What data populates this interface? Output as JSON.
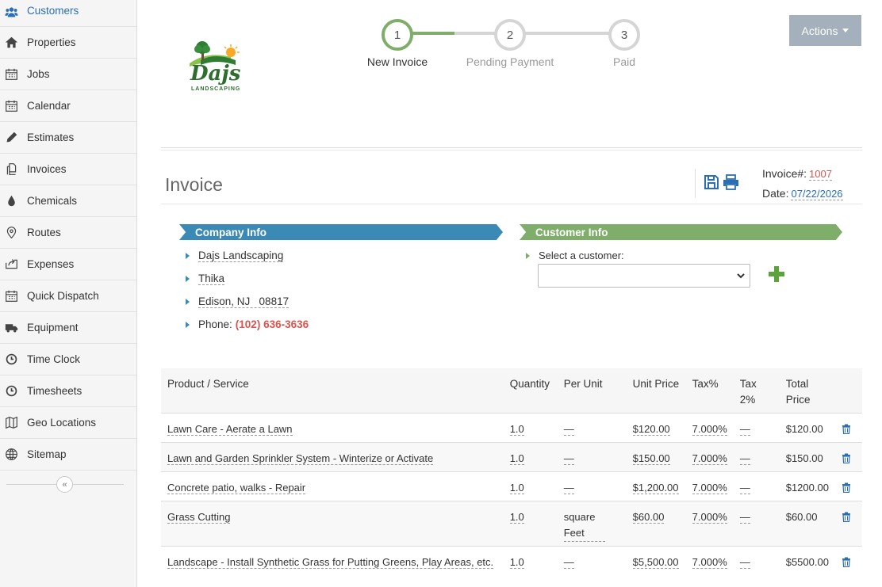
{
  "sidebar": {
    "items": [
      {
        "label": "Customers",
        "icon": "users-icon",
        "active": true
      },
      {
        "label": "Properties",
        "icon": "home-icon"
      },
      {
        "label": "Jobs",
        "icon": "calendar-icon"
      },
      {
        "label": "Calendar",
        "icon": "calendar-icon"
      },
      {
        "label": "Estimates",
        "icon": "pencil-icon"
      },
      {
        "label": "Invoices",
        "icon": "copy-icon"
      },
      {
        "label": "Chemicals",
        "icon": "drop-icon"
      },
      {
        "label": "Routes",
        "icon": "map-marker-icon"
      },
      {
        "label": "Expenses",
        "icon": "share-icon"
      },
      {
        "label": "Quick Dispatch",
        "icon": "calendar-icon"
      },
      {
        "label": "Equipment",
        "icon": "truck-icon"
      },
      {
        "label": "Time Clock",
        "icon": "clock-icon"
      },
      {
        "label": "Timesheets",
        "icon": "clock-icon"
      },
      {
        "label": "Geo Locations",
        "icon": "map-icon"
      },
      {
        "label": "Sitemap",
        "icon": "globe-icon"
      }
    ],
    "collapse_glyph": "«"
  },
  "logo": {
    "text": "Dajs",
    "subtext": "LANDSCAPING"
  },
  "steps": [
    {
      "number": "1",
      "label": "New Invoice",
      "done": true
    },
    {
      "number": "2",
      "label": "Pending Payment",
      "done": false
    },
    {
      "number": "3",
      "label": "Paid",
      "done": false
    }
  ],
  "actions_label": "Actions",
  "invoice": {
    "title": "Invoice",
    "number_label": "Invoice#:",
    "number": "1007",
    "date_label": "Date:",
    "date": "07/22/2026"
  },
  "company": {
    "banner": "Company Info",
    "name": "Dajs Landscaping",
    "line2": "Thika",
    "city_state": "Edison, NJ",
    "zip": "08817",
    "phone_label": "Phone:",
    "phone": "(102) 636-3636"
  },
  "customer": {
    "banner": "Customer Info",
    "select_label": "Select a customer:",
    "selected": ""
  },
  "table": {
    "headers": {
      "product": "Product / Service",
      "quantity": "Quantity",
      "per_unit": "Per Unit",
      "unit_price": "Unit Price",
      "tax": "Tax%",
      "tax2": "Tax 2%",
      "total": "Total Price"
    },
    "rows": [
      {
        "product": "Lawn Care - Aerate a Lawn",
        "quantity": "1.0",
        "per_unit": "—",
        "unit_price": "$120.00",
        "tax": "7.000%",
        "tax2": "—",
        "total": "$120.00"
      },
      {
        "product": "Lawn and Garden Sprinkler System - Winterize or Activate",
        "quantity": "1.0",
        "per_unit": "—",
        "unit_price": "$150.00",
        "tax": "7.000%",
        "tax2": "—",
        "total": "$150.00"
      },
      {
        "product": "Concrete patio, walks - Repair",
        "quantity": "1.0",
        "per_unit": "—",
        "unit_price": "$1,200.00",
        "tax": "7.000%",
        "tax2": "—",
        "total": "$1200.00"
      },
      {
        "product": "Grass Cutting",
        "quantity": "1.0",
        "per_unit": "square Feet",
        "unit_price": "$60.00",
        "tax": "7.000%",
        "tax2": "—",
        "total": "$60.00"
      },
      {
        "product": "Landscape - Install Synthetic Grass for Putting Greens, Play Areas, etc.",
        "quantity": "1.0",
        "per_unit": "—",
        "unit_price": "$5,500.00",
        "tax": "7.000%",
        "tax2": "—",
        "total": "$5500.00"
      }
    ]
  },
  "colors": {
    "accent_blue": "#2a6fb5",
    "company_banner": "#3a8ab5",
    "customer_banner": "#7fae6b",
    "invoice_number": "#d9534f",
    "actions_button": "#a4b1bc"
  }
}
